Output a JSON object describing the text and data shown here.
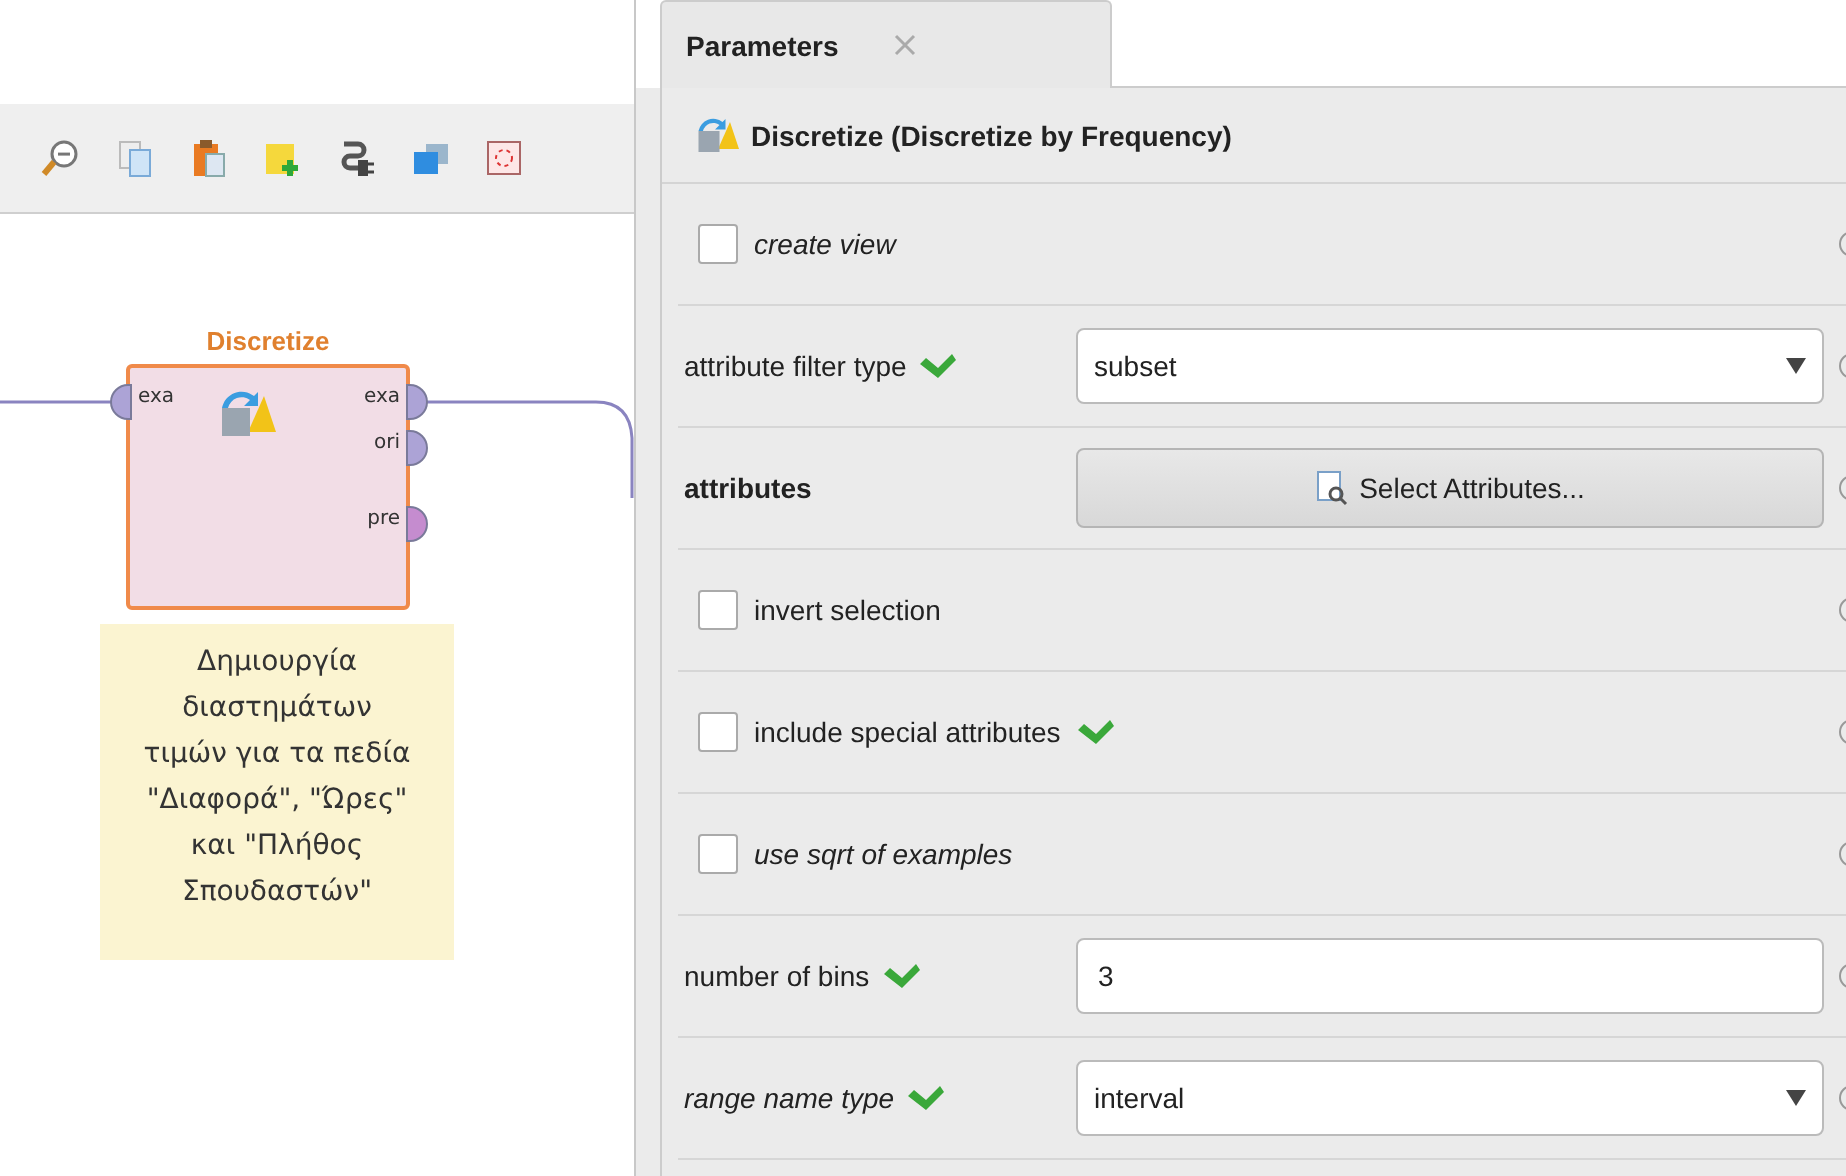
{
  "canvas": {
    "operator": {
      "title": "Discretize",
      "inputs": [
        {
          "label": "exa",
          "color": "#aca3d6"
        }
      ],
      "outputs": [
        {
          "label": "exa",
          "color": "#aca3d6"
        },
        {
          "label": "ori",
          "color": "#aca3d6"
        },
        {
          "label": "pre",
          "color": "#c58ccf"
        }
      ]
    },
    "note": "Δημιουργία\nδιαστημάτων\nτιμών για τα πεδία\n\"Διαφορά\", \"Ώρες\"\nκαι \"Πλήθος\nΣπουδαστών\""
  },
  "tab": {
    "label": "Parameters",
    "selected": true
  },
  "operator_title": "Discretize (Discretize by Frequency)",
  "parameters": [
    {
      "kind": "checkbox",
      "label": "create view",
      "italic": true,
      "bold": false,
      "checked": false,
      "marked": false
    },
    {
      "kind": "select",
      "label": "attribute filter type",
      "italic": false,
      "bold": false,
      "marked": true,
      "value": "subset"
    },
    {
      "kind": "button",
      "label": "attributes",
      "italic": false,
      "bold": true,
      "marked": false,
      "button": "Select Attributes..."
    },
    {
      "kind": "checkbox",
      "label": "invert selection",
      "italic": false,
      "bold": false,
      "checked": false,
      "marked": false
    },
    {
      "kind": "checkbox",
      "label": "include special attributes",
      "italic": false,
      "bold": false,
      "checked": false,
      "marked": true
    },
    {
      "kind": "checkbox",
      "label": "use sqrt of examples",
      "italic": true,
      "bold": false,
      "checked": false,
      "marked": false
    },
    {
      "kind": "text",
      "label": "number of bins",
      "italic": false,
      "bold": false,
      "marked": true,
      "value": "3"
    },
    {
      "kind": "select",
      "label": "range name type",
      "italic": true,
      "bold": false,
      "marked": true,
      "value": "interval"
    }
  ]
}
